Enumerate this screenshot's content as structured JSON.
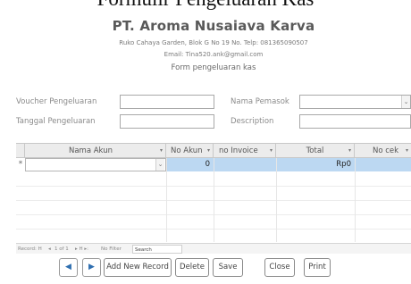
{
  "page_top_text": "Formulir Pengeluaran Kas",
  "header": {
    "company": "PT. Aroma Nusaiava Karva",
    "address": "Ruko Cahaya Garden, Blok G No 19 No. Telp: 081365090507",
    "email": "Email: Tina520.ank@gmail.com",
    "form_title": "Form  pengeluaran kas"
  },
  "fields": {
    "voucher_label": "Voucher Pengeluaran",
    "tanggal_label": "Tanggal Pengeluaran",
    "pemasok_label": "Nama Pemasok",
    "description_label": "Description",
    "voucher_value": "",
    "tanggal_value": "",
    "pemasok_value": "",
    "description_value": ""
  },
  "grid": {
    "columns": [
      "Nama Akun",
      "No Akun",
      "no Invoice",
      "Total",
      "No cek"
    ],
    "row_selector": "*",
    "rows": [
      {
        "nama_akun": "",
        "no_akun": "0",
        "no_invoice": "",
        "total": "Rp0",
        "no_cek": ""
      }
    ]
  },
  "record_nav": {
    "record_label": "Record: H",
    "prev_symbol": "◂",
    "position": "1 of 1",
    "next_last": "▸  H ▸:",
    "filter": "No Filter",
    "search": "Search"
  },
  "buttons": {
    "prev_icon": "◀",
    "next_icon": "▶",
    "add": "Add New Record",
    "delete": "Delete",
    "save": "Save",
    "close": "Close",
    "print": "Print"
  },
  "colors": {
    "highlight": "#bcd8f2",
    "nav_arrow": "#2f6fb0"
  }
}
